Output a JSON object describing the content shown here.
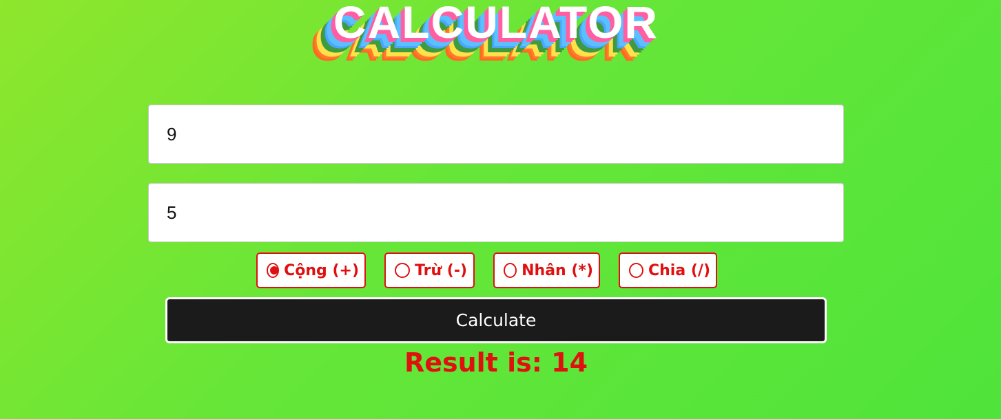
{
  "title": "CALCULATOR",
  "inputs": {
    "first_value": "9",
    "second_value": "5"
  },
  "operations": [
    {
      "label": "Cộng (+)",
      "selected": true
    },
    {
      "label": "Trừ (-)",
      "selected": false
    },
    {
      "label": "Nhân (*)",
      "selected": false
    },
    {
      "label": "Chia (/)",
      "selected": false
    }
  ],
  "calculate_label": "Calculate",
  "result_text": "Result is: 14",
  "colors": {
    "accent": "#e01010",
    "button_bg": "#1b1b1b",
    "background": "#66e638"
  }
}
